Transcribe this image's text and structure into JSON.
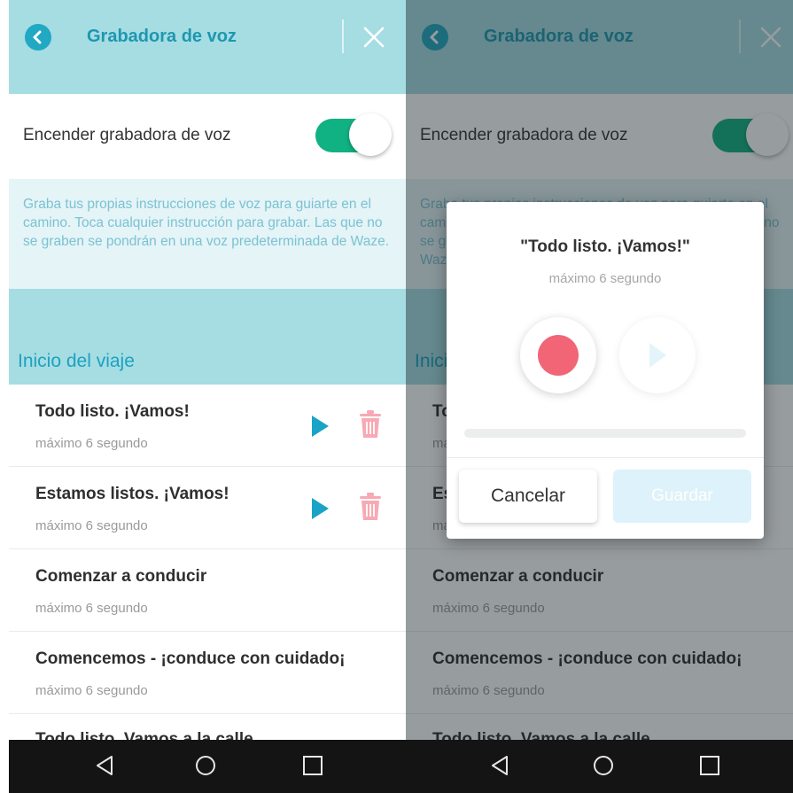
{
  "app": {
    "title": "Grabadora de voz"
  },
  "toggle": {
    "label": "Encender grabadora de voz",
    "state": "on"
  },
  "info": {
    "text": "Graba tus propias instrucciones de voz para guiarte en el camino. Toca cualquier instrucción para grabar. Las que no se graben se pondrán en una voz predeterminada de Waze."
  },
  "section": {
    "title": "Inicio del viaje"
  },
  "items": [
    {
      "title": "Todo listo. ¡Vamos!",
      "subtitle": "máximo 6 segundo",
      "recorded": true
    },
    {
      "title": "Estamos listos. ¡Vamos!",
      "subtitle": "máximo 6 segundo",
      "recorded": true
    },
    {
      "title": "Comenzar a conducir",
      "subtitle": "máximo 6 segundo",
      "recorded": false
    },
    {
      "title": "Comencemos - ¡conduce con cuidado¡",
      "subtitle": "máximo 6 segundo",
      "recorded": false
    },
    {
      "title": "Todo listo. Vamos a la calle",
      "subtitle": "",
      "recorded": false
    }
  ],
  "dialog": {
    "title": "\"Todo listo. ¡Vamos!\"",
    "subtitle": "máximo 6 segundo",
    "progress": 0,
    "cancel_label": "Cancelar",
    "save_label": "Guardar"
  },
  "icons": {
    "back": "back-arrow-icon",
    "close": "close-icon",
    "play": "play-icon",
    "delete": "trash-icon",
    "record": "record-icon",
    "nav_back": "nav-back-icon",
    "nav_home": "nav-home-icon",
    "nav_recents": "nav-recents-icon"
  },
  "colors": {
    "header_bg": "#a5dde3",
    "accent": "#1e97b0",
    "toggle_on": "#10b182",
    "info_bg": "#e4f4f7",
    "record": "#f16577",
    "delete": "#f7a9b4",
    "play": "#1aa3c6"
  }
}
